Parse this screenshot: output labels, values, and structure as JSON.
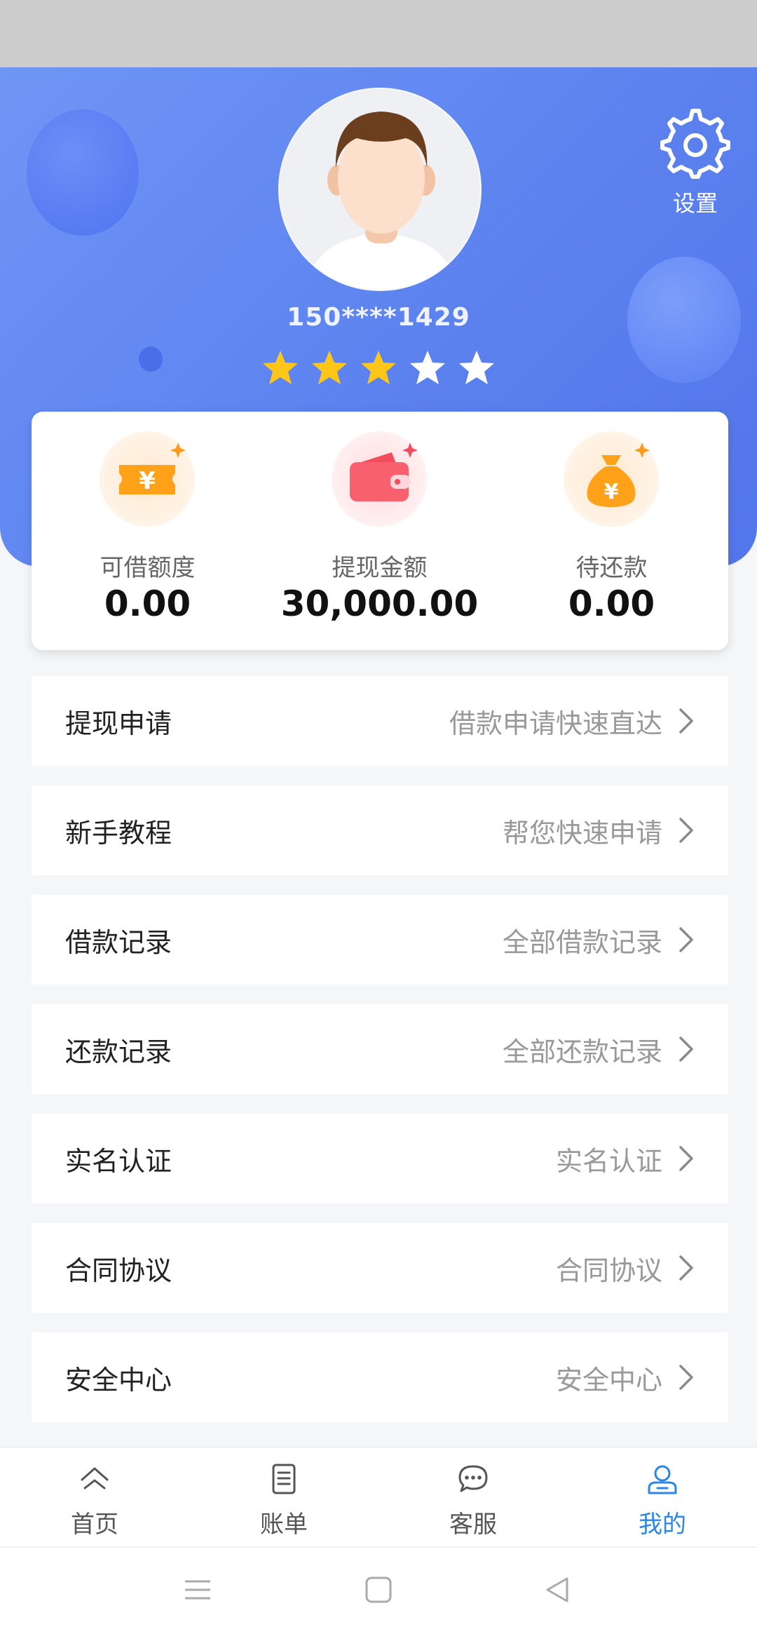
{
  "header": {
    "phone": "150****1429",
    "settings_label": "设置",
    "rating": {
      "filled": 3,
      "total": 5
    }
  },
  "stats": [
    {
      "label": "可借额度",
      "value": "0.00",
      "icon": "voucher-icon"
    },
    {
      "label": "提现金额",
      "value": "30,000.00",
      "icon": "wallet-icon"
    },
    {
      "label": "待还款",
      "value": "0.00",
      "icon": "money-bag-icon"
    }
  ],
  "menu": [
    {
      "title": "提现申请",
      "subtitle": "借款申请快速直达"
    },
    {
      "title": "新手教程",
      "subtitle": "帮您快速申请"
    },
    {
      "title": "借款记录",
      "subtitle": "全部借款记录"
    },
    {
      "title": "还款记录",
      "subtitle": "全部还款记录"
    },
    {
      "title": "实名认证",
      "subtitle": "实名认证"
    },
    {
      "title": "合同协议",
      "subtitle": "合同协议"
    },
    {
      "title": "安全中心",
      "subtitle": "安全中心"
    }
  ],
  "nav": [
    {
      "label": "首页",
      "icon": "home-icon"
    },
    {
      "label": "账单",
      "icon": "bill-icon"
    },
    {
      "label": "客服",
      "icon": "chat-icon"
    },
    {
      "label": "我的",
      "icon": "user-icon",
      "active": true
    }
  ],
  "colors": {
    "header_gradient_start": "#6f95f6",
    "header_gradient_end": "#5275eb",
    "star_filled": "#ffc61a",
    "star_empty": "#ffffff",
    "nav_active": "#2a86e8"
  }
}
